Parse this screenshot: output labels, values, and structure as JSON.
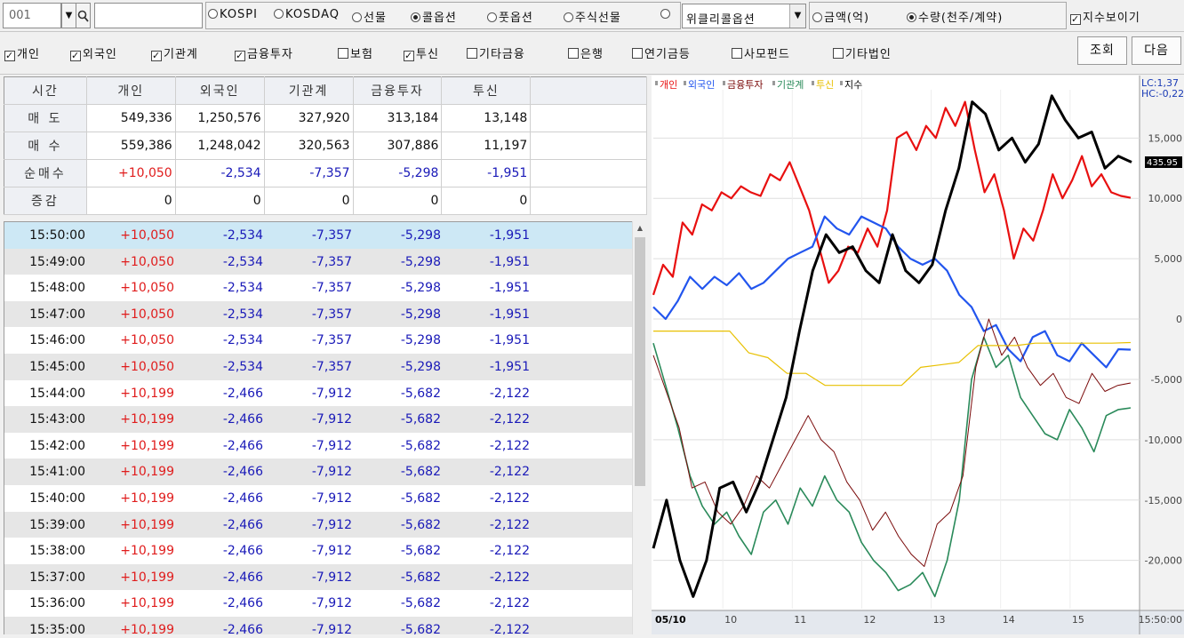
{
  "toolbar": {
    "code": "001",
    "markets": [
      {
        "label": "KOSPI",
        "selected": false
      },
      {
        "label": "KOSDAQ",
        "selected": false
      },
      {
        "label": "선물",
        "selected": false
      },
      {
        "label": "콜옵션",
        "selected": true
      },
      {
        "label": "풋옵션",
        "selected": false
      },
      {
        "label": "주식선물",
        "selected": false
      }
    ],
    "combo_label": "위클리콜옵션",
    "units": [
      {
        "label": "금액(억)",
        "selected": false
      },
      {
        "label": "수량(천주/계약)",
        "selected": true
      }
    ],
    "show_index_label": "지수보이기",
    "show_index_checked": true
  },
  "investor_filters": [
    {
      "label": "개인",
      "checked": true
    },
    {
      "label": "외국인",
      "checked": true
    },
    {
      "label": "기관계",
      "checked": true
    },
    {
      "label": "금융투자",
      "checked": true
    },
    {
      "label": "보험",
      "checked": false
    },
    {
      "label": "투신",
      "checked": true
    },
    {
      "label": "기타금융",
      "checked": false
    },
    {
      "label": "은행",
      "checked": false
    },
    {
      "label": "연기금등",
      "checked": false
    },
    {
      "label": "사모펀드",
      "checked": false
    },
    {
      "label": "기타법인",
      "checked": false
    }
  ],
  "buttons": {
    "query": "조회",
    "next": "다음"
  },
  "summary": {
    "headers": [
      "시간",
      "개인",
      "외국인",
      "기관계",
      "금융투자",
      "투신"
    ],
    "rows": [
      {
        "label": "매 도",
        "values": [
          "549,336",
          "1,250,576",
          "327,920",
          "313,184",
          "13,148"
        ]
      },
      {
        "label": "매 수",
        "values": [
          "559,386",
          "1,248,042",
          "320,563",
          "307,886",
          "11,197"
        ]
      },
      {
        "label": "순매수",
        "values": [
          "+10,050",
          "-2,534",
          "-7,357",
          "-5,298",
          "-1,951"
        ]
      },
      {
        "label": "증감",
        "values": [
          "0",
          "0",
          "0",
          "0",
          "0"
        ]
      }
    ]
  },
  "timeseries": [
    {
      "time": "15:50:00",
      "values": [
        "+10,050",
        "-2,534",
        "-7,357",
        "-5,298",
        "-1,951"
      ]
    },
    {
      "time": "15:49:00",
      "values": [
        "+10,050",
        "-2,534",
        "-7,357",
        "-5,298",
        "-1,951"
      ]
    },
    {
      "time": "15:48:00",
      "values": [
        "+10,050",
        "-2,534",
        "-7,357",
        "-5,298",
        "-1,951"
      ]
    },
    {
      "time": "15:47:00",
      "values": [
        "+10,050",
        "-2,534",
        "-7,357",
        "-5,298",
        "-1,951"
      ]
    },
    {
      "time": "15:46:00",
      "values": [
        "+10,050",
        "-2,534",
        "-7,357",
        "-5,298",
        "-1,951"
      ]
    },
    {
      "time": "15:45:00",
      "values": [
        "+10,050",
        "-2,534",
        "-7,357",
        "-5,298",
        "-1,951"
      ]
    },
    {
      "time": "15:44:00",
      "values": [
        "+10,199",
        "-2,466",
        "-7,912",
        "-5,682",
        "-2,122"
      ]
    },
    {
      "time": "15:43:00",
      "values": [
        "+10,199",
        "-2,466",
        "-7,912",
        "-5,682",
        "-2,122"
      ]
    },
    {
      "time": "15:42:00",
      "values": [
        "+10,199",
        "-2,466",
        "-7,912",
        "-5,682",
        "-2,122"
      ]
    },
    {
      "time": "15:41:00",
      "values": [
        "+10,199",
        "-2,466",
        "-7,912",
        "-5,682",
        "-2,122"
      ]
    },
    {
      "time": "15:40:00",
      "values": [
        "+10,199",
        "-2,466",
        "-7,912",
        "-5,682",
        "-2,122"
      ]
    },
    {
      "time": "15:39:00",
      "values": [
        "+10,199",
        "-2,466",
        "-7,912",
        "-5,682",
        "-2,122"
      ]
    },
    {
      "time": "15:38:00",
      "values": [
        "+10,199",
        "-2,466",
        "-7,912",
        "-5,682",
        "-2,122"
      ]
    },
    {
      "time": "15:37:00",
      "values": [
        "+10,199",
        "-2,466",
        "-7,912",
        "-5,682",
        "-2,122"
      ]
    },
    {
      "time": "15:36:00",
      "values": [
        "+10,199",
        "-2,466",
        "-7,912",
        "-5,682",
        "-2,122"
      ]
    },
    {
      "time": "15:35:00",
      "values": [
        "+10,199",
        "-2,466",
        "-7,912",
        "-5,682",
        "-2,122"
      ]
    }
  ],
  "chart_data": {
    "type": "line",
    "legend": [
      {
        "name": "개인",
        "color": "#e81010"
      },
      {
        "name": "외국인",
        "color": "#2255ee"
      },
      {
        "name": "금융투자",
        "color": "#7a0a0a"
      },
      {
        "name": "기관계",
        "color": "#2a8a5a"
      },
      {
        "name": "투신",
        "color": "#e8c000"
      },
      {
        "name": "지수",
        "color": "#000000"
      }
    ],
    "y_ticks": [
      "15,000",
      "10,000",
      "5,000",
      "0",
      "-5,000",
      "-10,000",
      "-15,000",
      "-20,000"
    ],
    "ylim": [
      -24000,
      19000
    ],
    "x_ticks": [
      "05/10",
      "10",
      "11",
      "12",
      "13",
      "14",
      "15"
    ],
    "lc_label": "LC:1,37",
    "hc_label": "HC:-0,22",
    "index_badge": "435.95",
    "last_time": "15:50:00",
    "series": [
      {
        "name": "개인",
        "color": "#e81010",
        "width": 2.2,
        "values": [
          2000,
          4500,
          3500,
          8000,
          7000,
          9500,
          9000,
          10500,
          10000,
          11000,
          10500,
          10200,
          12000,
          11500,
          13000,
          11000,
          9000,
          6000,
          3000,
          4000,
          6000,
          5500,
          7500,
          6000,
          9000,
          15000,
          15500,
          14000,
          16000,
          15000,
          17500,
          16000,
          18000,
          14000,
          10500,
          12000,
          9000,
          5000,
          7500,
          6500,
          9000,
          12000,
          10000,
          11500,
          13500,
          11000,
          12000,
          10500,
          10200,
          10050
        ]
      },
      {
        "name": "외국인",
        "color": "#2255ee",
        "width": 2.2,
        "values": [
          1000,
          0,
          1500,
          3500,
          2500,
          3500,
          2800,
          3800,
          2500,
          3000,
          4000,
          5000,
          5500,
          6000,
          8500,
          7500,
          7000,
          8500,
          8000,
          7500,
          6000,
          5000,
          4500,
          5000,
          4000,
          2000,
          1000,
          -1000,
          -500,
          -2500,
          -3500,
          -1500,
          -1000,
          -3000,
          -3500,
          -2000,
          -3000,
          -4000,
          -2500,
          -2534
        ]
      },
      {
        "name": "기관계",
        "color": "#2a8a5a",
        "width": 1.6,
        "values": [
          -2000,
          -5500,
          -9000,
          -13000,
          -15500,
          -17000,
          -16000,
          -18000,
          -19500,
          -16000,
          -15000,
          -17000,
          -14000,
          -15500,
          -13000,
          -15000,
          -16000,
          -18500,
          -20000,
          -21000,
          -22500,
          -22000,
          -21000,
          -23000,
          -20000,
          -15000,
          -5000,
          -1500,
          -4000,
          -3000,
          -6500,
          -8000,
          -9500,
          -10000,
          -7500,
          -9000,
          -11000,
          -8000,
          -7500,
          -7357
        ]
      },
      {
        "name": "금융투자",
        "color": "#7a0a0a",
        "width": 1.0,
        "values": [
          -3000,
          -6000,
          -9000,
          -14000,
          -13500,
          -16000,
          -17000,
          -15500,
          -13000,
          -14000,
          -12000,
          -10000,
          -8000,
          -10000,
          -11000,
          -13500,
          -15000,
          -17500,
          -16000,
          -18000,
          -19500,
          -20500,
          -17000,
          -16000,
          -13000,
          -4000,
          0,
          -3000,
          -1500,
          -4000,
          -5500,
          -4500,
          -6500,
          -7000,
          -4500,
          -6000,
          -5500,
          -5298
        ]
      },
      {
        "name": "투신",
        "color": "#e8c000",
        "width": 1.2,
        "values": [
          -1000,
          -1000,
          -1000,
          -1000,
          -1000,
          -2800,
          -3200,
          -4500,
          -4500,
          -5500,
          -5500,
          -5500,
          -5500,
          -5500,
          -4000,
          -3800,
          -3600,
          -2200,
          -2200,
          -2200,
          -2000,
          -2000,
          -2000,
          -2000,
          -2000,
          -1951
        ]
      },
      {
        "name": "지수",
        "color": "#000000",
        "width": 3.0,
        "values": [
          -19000,
          -15000,
          -20000,
          -23000,
          -20000,
          -14000,
          -13500,
          -16000,
          -13500,
          -10000,
          -6500,
          -1000,
          4000,
          7000,
          5500,
          6000,
          4000,
          3000,
          7000,
          4000,
          3000,
          4500,
          9000,
          12500,
          18000,
          17000,
          14000,
          15000,
          13000,
          14500,
          18500,
          16500,
          15000,
          15500,
          12500,
          13500,
          13000
        ]
      }
    ]
  }
}
